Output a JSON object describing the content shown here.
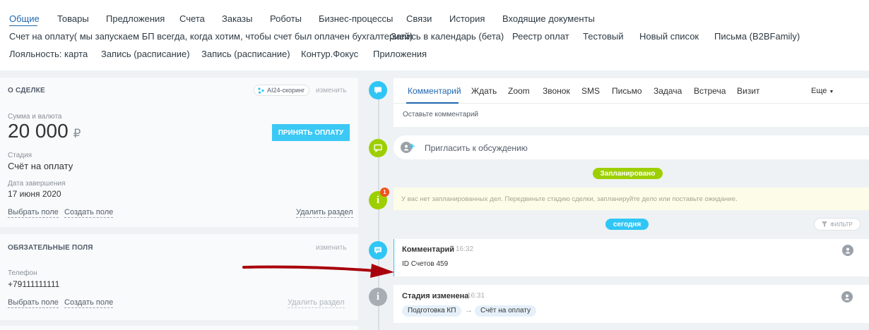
{
  "tabs": {
    "row1": [
      "Общие",
      "Товары",
      "Предложения",
      "Счета",
      "Заказы",
      "Роботы",
      "Бизнес-процессы",
      "Связи",
      "История",
      "Входящие документы"
    ],
    "row2": [
      "Счет на оплату( мы запускаем БП всегда, когда хотим, чтобы счет был оплачен бухгалтерией)",
      "Запись в календарь (бета)",
      "Реестр оплат",
      "Тестовый",
      "Новый список",
      "Письма (B2BFamily)"
    ],
    "row3": [
      "Лояльность: карта",
      "Запись (расписание)",
      "Запись (расписание)",
      "Контур.Фокус",
      "Приложения"
    ]
  },
  "deal": {
    "title": "О СДЕЛКЕ",
    "scoring_label": "AI24-скоринг",
    "edit": "изменить",
    "amount_label": "Сумма и валюта",
    "amount": "20 000",
    "currency": "₽",
    "accept_button": "ПРИНЯТЬ ОПЛАТУ",
    "stage_label": "Стадия",
    "stage": "Счёт на оплату",
    "date_label": "Дата завершения",
    "date": "17 июня 2020",
    "choose_field": "Выбрать поле",
    "create_field": "Создать поле",
    "delete_section": "Удалить раздел"
  },
  "required": {
    "title": "ОБЯЗАТЕЛЬНЫЕ ПОЛЯ",
    "edit": "изменить",
    "phone_label": "Телефон",
    "phone": "+79111111111",
    "choose_field": "Выбрать поле",
    "create_field": "Создать поле",
    "delete_section": "Удалить раздел"
  },
  "activity": {
    "tabs": [
      "Комментарий",
      "Ждать",
      "Zoom",
      "Звонок",
      "SMS",
      "Письмо",
      "Задача",
      "Встреча",
      "Визит"
    ],
    "more": "Еще",
    "placeholder": "Оставьте комментарий"
  },
  "invite": "Пригласить к обсуждению",
  "planned_label": "Запланировано",
  "notice_count": "1",
  "notice": "У вас нет запланированных дел. Передвиньте стадию сделки, запланируйте дело или поставьте ожидание.",
  "today_label": "сегодня",
  "filter_label": "ФИЛЬТР",
  "comment_item": {
    "title": "Комментарий",
    "time": "16:32",
    "text": "ID Счетов 459"
  },
  "stage_item": {
    "title": "Стадия изменена",
    "time": "16:31",
    "from": "Подготовка КП",
    "arrow": "→",
    "to": "Счёт на оплату"
  },
  "colors": {
    "accent": "#2067b0",
    "button": "#3bc8f5",
    "green": "#9dcf00",
    "red": "#a8000c",
    "blue_icon": "#2fc6f6",
    "grey_icon": "#a8adb4"
  }
}
